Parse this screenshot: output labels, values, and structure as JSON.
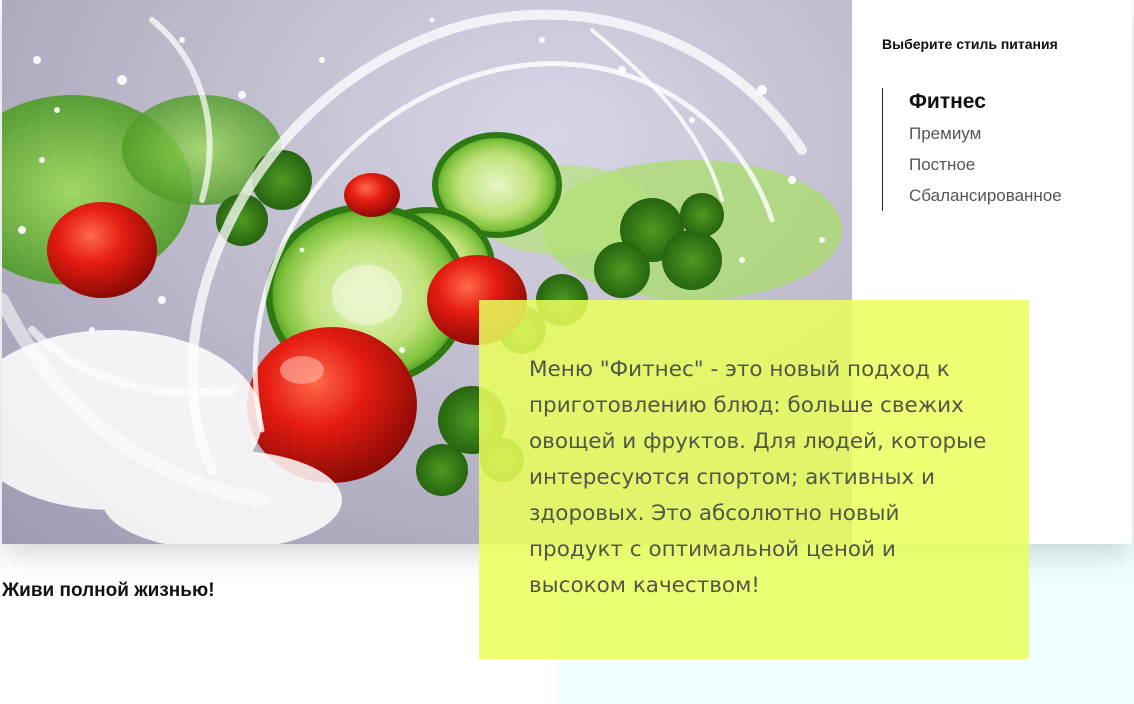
{
  "hero": {
    "image_icon": "salad-water-splash-image"
  },
  "style_panel": {
    "title": "Выберите стиль питания",
    "items": [
      {
        "label": "Фитнес",
        "active": true
      },
      {
        "label": "Премиум",
        "active": false
      },
      {
        "label": "Постное",
        "active": false
      },
      {
        "label": "Сбалансированное",
        "active": false
      }
    ]
  },
  "description": {
    "text": "Меню \"Фитнес\" - это новый подход к приготовлению блюд: больше свежих овощей и фруктов. Для людей, которые интересуются спортом; активных и здоровых. Это абсолютно новый продукт с оптимальной ценой и высоком качеством!"
  },
  "tagline": "Живи полной жизнью!",
  "colors": {
    "highlight_box": "#eaff5c",
    "mint_block": "#effefe",
    "text_dark": "#111111",
    "text_muted": "#555555"
  }
}
